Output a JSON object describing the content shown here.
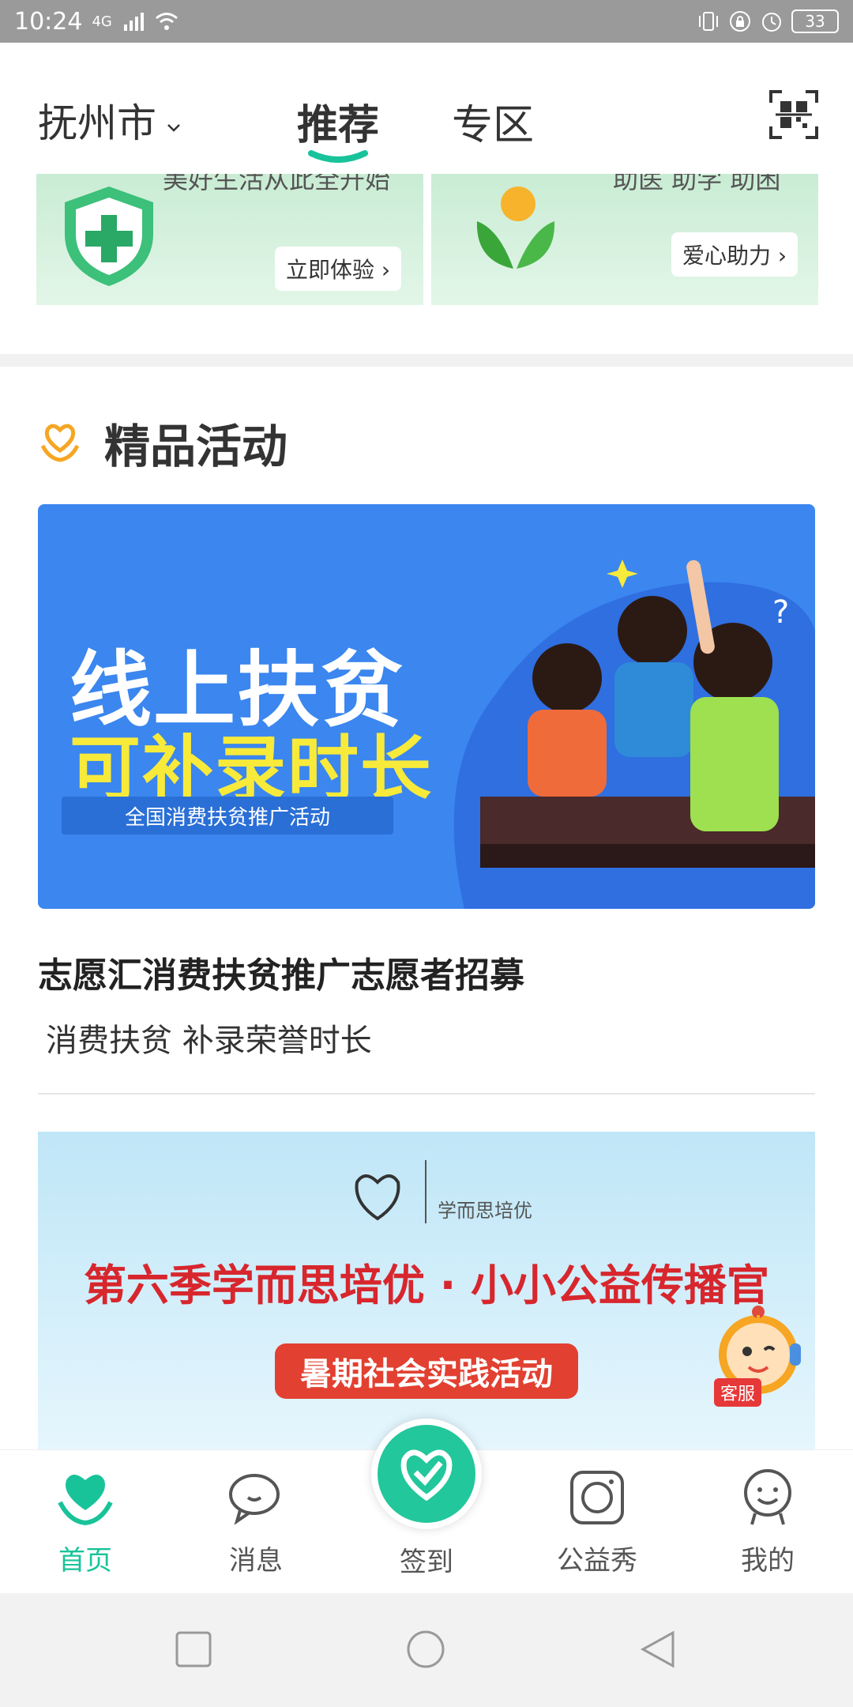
{
  "status_bar": {
    "time": "10:24",
    "network": "4G",
    "battery": "33"
  },
  "top_nav": {
    "city": "抚州市",
    "tabs": [
      {
        "label": "推荐",
        "active": true
      },
      {
        "label": "专区",
        "active": false
      }
    ]
  },
  "banners": [
    {
      "cut_text": "美好生活从此全开始",
      "button": "立即体验",
      "icon": "plus-shield-icon"
    },
    {
      "cut_text": "助医 助学 助困",
      "button": "爱心助力",
      "icon": "leaf-sun-icon"
    }
  ],
  "section": {
    "title": "精品活动",
    "icon": "heart-hands-icon"
  },
  "activities": [
    {
      "poster_line1": "线上扶贫",
      "poster_line2": "可补录时长",
      "poster_line3": "全国消费扶贫推广活动",
      "title": "志愿汇消费扶贫推广志愿者招募",
      "subtitle": "消费扶贫 补录荣誉时长"
    },
    {
      "poster_org": "学而思培优",
      "poster_main": "第六季学而思培优 · 小小公益传播官",
      "poster_pill": "暑期社会实践活动"
    }
  ],
  "customer_service": {
    "label": "客服"
  },
  "tab_bar": {
    "items": [
      {
        "label": "首页",
        "icon": "heart-hands-icon",
        "active": true
      },
      {
        "label": "消息",
        "icon": "chat-bubble-icon",
        "active": false
      },
      {
        "label": "签到",
        "icon": "check-heart-icon",
        "active": false
      },
      {
        "label": "公益秀",
        "icon": "camera-icon",
        "active": false
      },
      {
        "label": "我的",
        "icon": "smile-face-icon",
        "active": false
      }
    ]
  },
  "colors": {
    "accent": "#19c39a",
    "poster_blue": "#3b86ef",
    "poster_yellow": "#f7ea3a",
    "red": "#e24031"
  }
}
